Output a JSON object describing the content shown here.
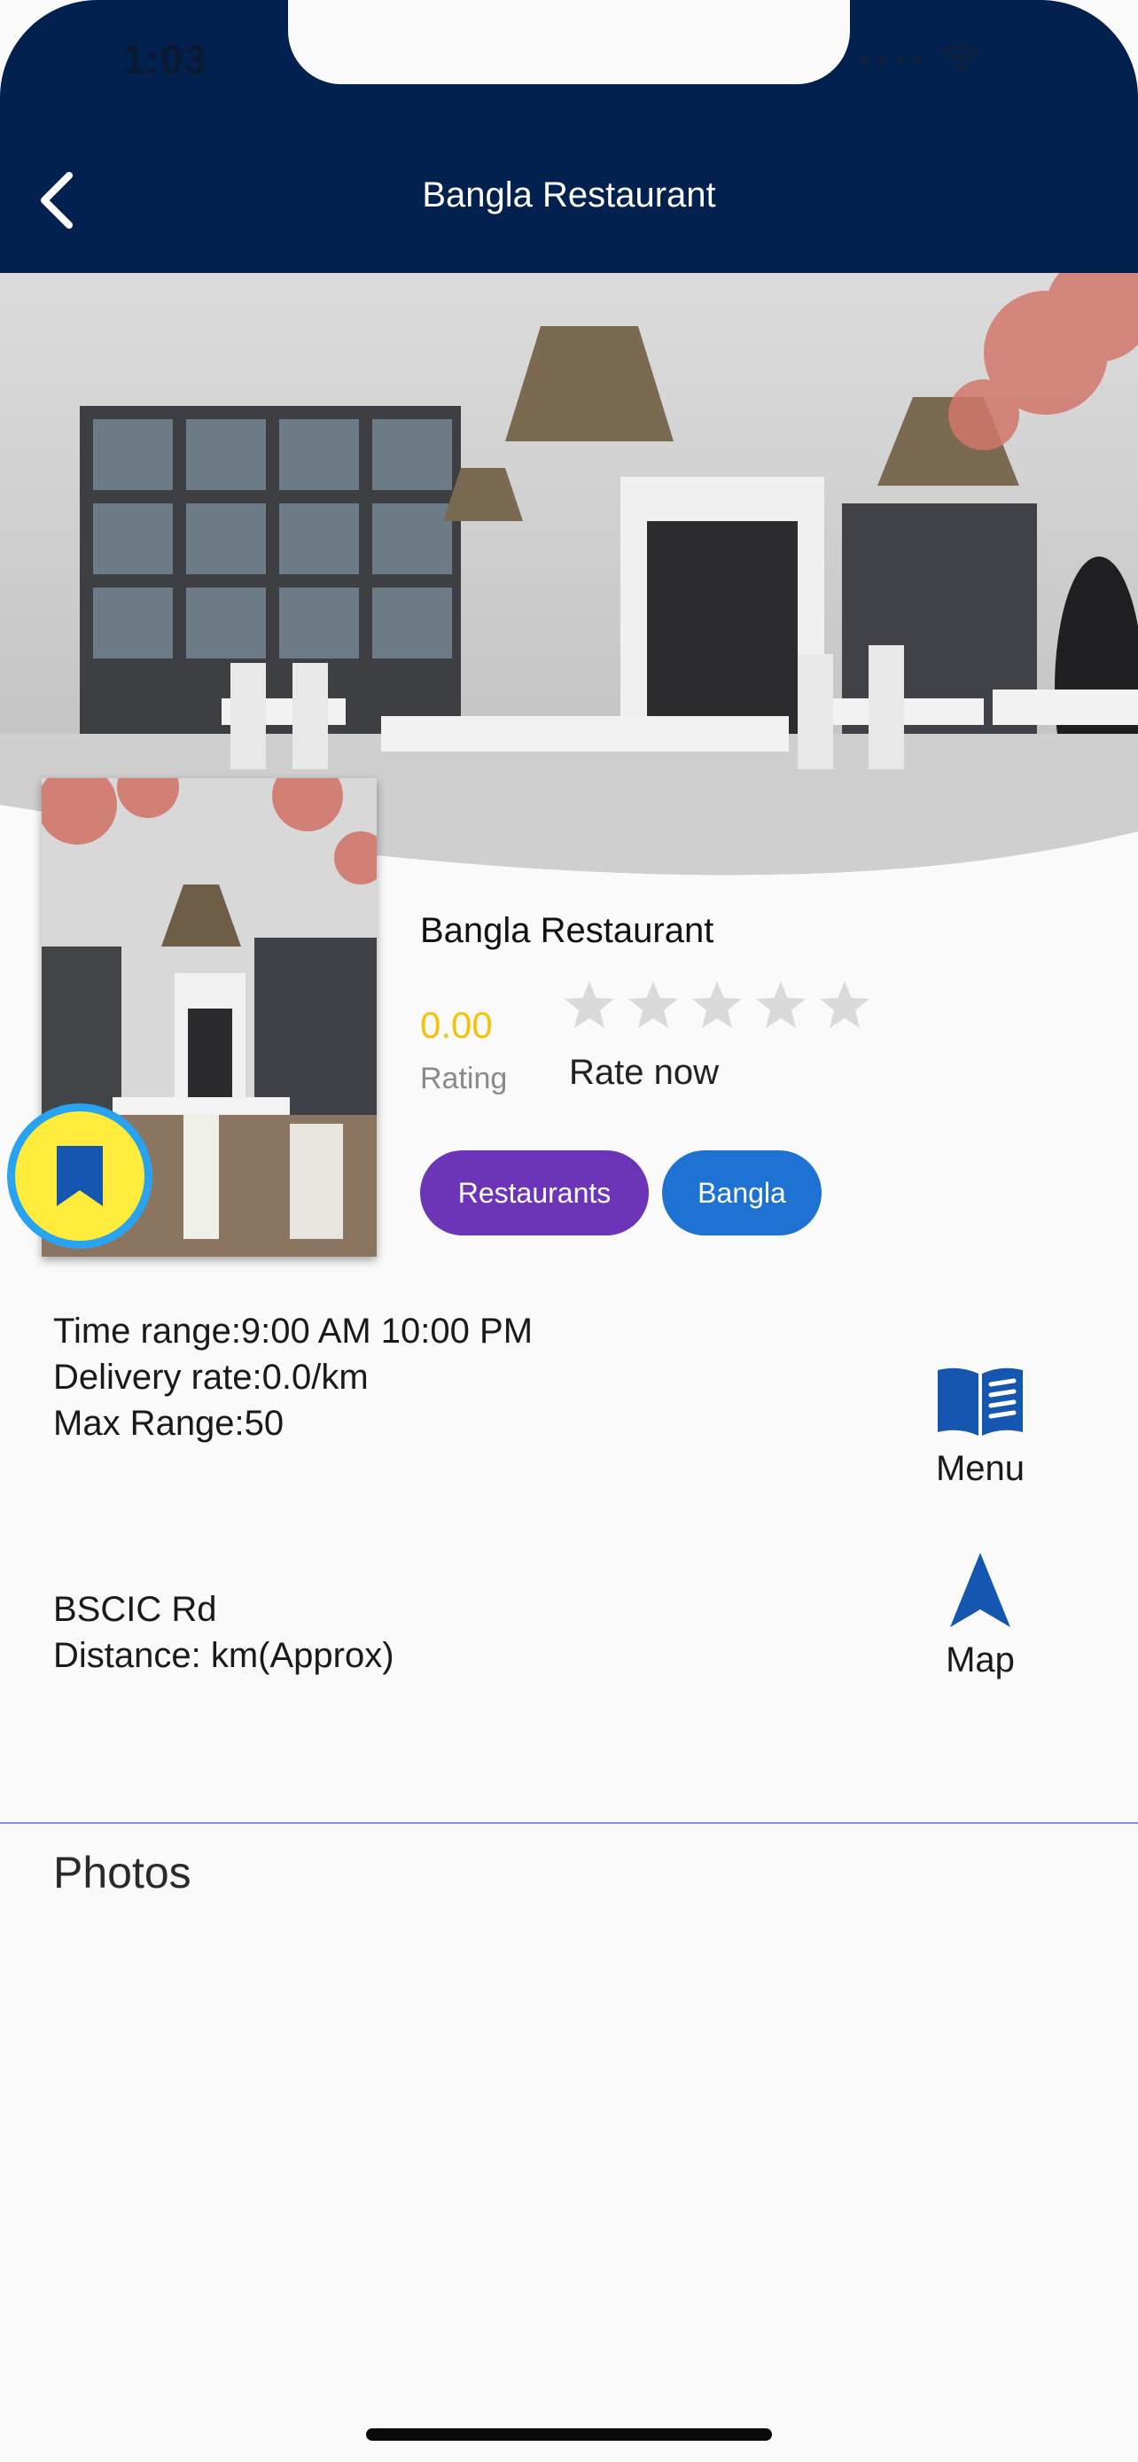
{
  "status_bar": {
    "time": "1:03"
  },
  "header": {
    "title": "Bangla Restaurant",
    "back_icon": "chevron-left-icon"
  },
  "place": {
    "name": "Bangla Restaurant",
    "rating_value": "0.00",
    "rating_label": "Rating",
    "rate_now_label": "Rate now",
    "stars_filled": 0,
    "stars_total": 5,
    "categories": [
      "Restaurants",
      "Bangla"
    ]
  },
  "details": {
    "time_range": "Time range:9:00 AM 10:00 PM",
    "delivery_rate": "Delivery rate:0.0/km",
    "max_range": "Max Range:50",
    "address": "BSCIC Rd",
    "distance": "Distance: km(Approx)"
  },
  "actions": {
    "menu_label": "Menu",
    "map_label": "Map"
  },
  "photos": {
    "title": "Photos"
  },
  "colors": {
    "header_bg": "#03214f",
    "rating": "#f4c20d",
    "chip_primary": "#6c35b8",
    "chip_secondary": "#1d72d3",
    "fab_bg": "#ffeb3b",
    "fab_ring": "#29a3f0",
    "icon_blue": "#1557b0"
  }
}
